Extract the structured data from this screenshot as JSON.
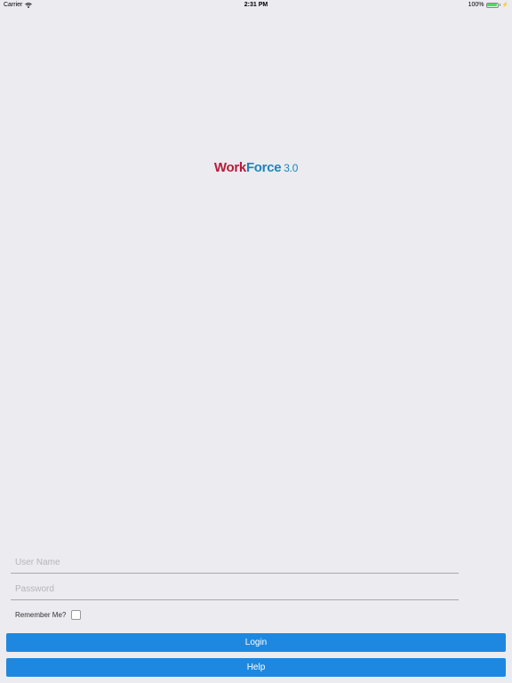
{
  "status_bar": {
    "carrier": "Carrier",
    "time": "2:31 PM",
    "battery": "100%",
    "battery_level": 1.0
  },
  "logo": {
    "work": "Work",
    "force": "Force",
    "version": "3.0"
  },
  "login_form": {
    "username_placeholder": "User Name",
    "password_placeholder": "Password",
    "remember_label": "Remember Me?",
    "login_label": "Login",
    "help_label": "Help"
  },
  "colors": {
    "background": "#ebebf0",
    "button": "#1e88e0",
    "logo_work": "#b81a3a",
    "logo_force": "#1b86b8"
  }
}
